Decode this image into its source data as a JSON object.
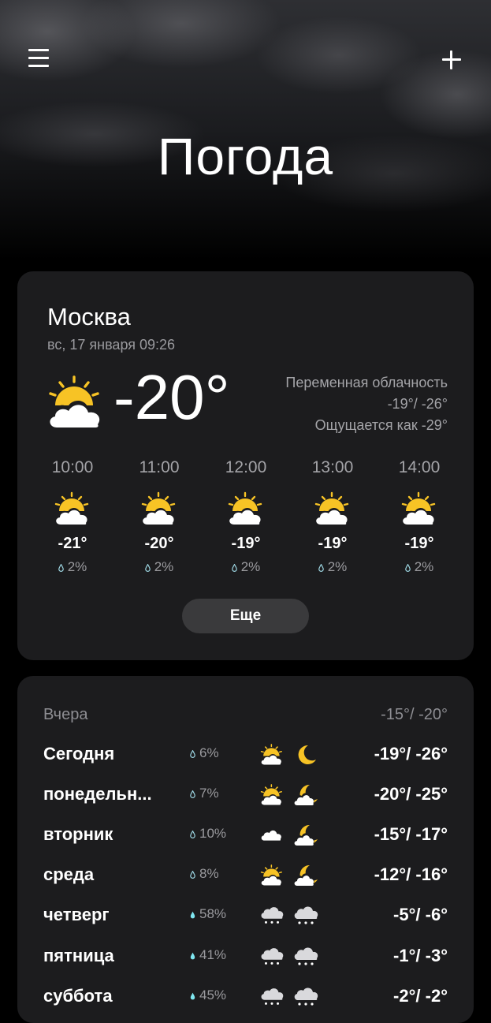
{
  "header": {
    "title": "Погода",
    "menu_icon": "hamburger-menu-icon",
    "add_icon": "plus-icon"
  },
  "current": {
    "city": "Москва",
    "datetime": "вс, 17 января 09:26",
    "temp": "-20°",
    "condition": "Переменная облачность",
    "hi_lo": "-19°/ -26°",
    "feels_like": "Ощущается как -29°",
    "icon": "partly-cloudy-icon"
  },
  "hourly": [
    {
      "time": "10:00",
      "temp": "-21°",
      "precip": "2%",
      "icon": "partly-cloudy-icon"
    },
    {
      "time": "11:00",
      "temp": "-20°",
      "precip": "2%",
      "icon": "partly-cloudy-icon"
    },
    {
      "time": "12:00",
      "temp": "-19°",
      "precip": "2%",
      "icon": "partly-cloudy-icon"
    },
    {
      "time": "13:00",
      "temp": "-19°",
      "precip": "2%",
      "icon": "partly-cloudy-icon"
    },
    {
      "time": "14:00",
      "temp": "-19°",
      "precip": "2%",
      "icon": "partly-cloudy-icon"
    }
  ],
  "more_label": "Еще",
  "forecast": {
    "yesterday": {
      "label": "Вчера",
      "temps": "-15°/ -20°"
    },
    "days": [
      {
        "name": "Сегодня",
        "precip": "6%",
        "day_icon": "partly-cloudy-icon",
        "night_icon": "moon-icon",
        "temps": "-19°/ -26°"
      },
      {
        "name": "понедельн...",
        "precip": "7%",
        "day_icon": "partly-cloudy-icon",
        "night_icon": "cloudy-night-icon",
        "temps": "-20°/ -25°"
      },
      {
        "name": "вторник",
        "precip": "10%",
        "day_icon": "cloud-icon",
        "night_icon": "cloudy-night-icon",
        "temps": "-15°/ -17°"
      },
      {
        "name": "среда",
        "precip": "8%",
        "day_icon": "partly-cloudy-icon",
        "night_icon": "cloudy-night-icon",
        "temps": "-12°/ -16°"
      },
      {
        "name": "четверг",
        "precip": "58%",
        "day_icon": "snow-icon",
        "night_icon": "snow-icon",
        "temps": "-5°/ -6°"
      },
      {
        "name": "пятница",
        "precip": "41%",
        "day_icon": "snow-icon",
        "night_icon": "snow-icon",
        "temps": "-1°/ -3°"
      },
      {
        "name": "суббота",
        "precip": "45%",
        "day_icon": "snow-icon",
        "night_icon": "snow-icon",
        "temps": "-2°/ -2°"
      }
    ]
  },
  "colors": {
    "background": "#000000",
    "card": "#1c1c1e",
    "button": "#3a3a3c",
    "sun": "#f7c325",
    "cloud": "#ffffff",
    "drop_low": "#9bd3df",
    "drop_high": "#7fe6f0",
    "secondary_text": "#a4a4a8"
  }
}
